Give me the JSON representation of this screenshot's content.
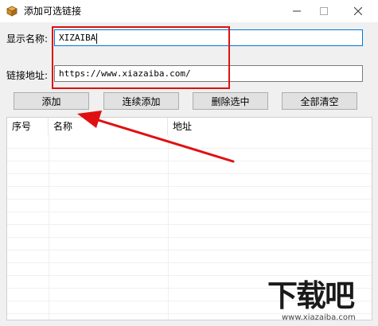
{
  "window": {
    "title": "添加可选链接"
  },
  "form": {
    "name_label": "显示名称:",
    "name_value": "XIZAIBA",
    "url_label": "链接地址:",
    "url_value": "https://www.xiazaiba.com/"
  },
  "buttons": {
    "add": "添加",
    "add_continuous": "连续添加",
    "delete_selected": "删除选中",
    "clear_all": "全部清空"
  },
  "list": {
    "columns": [
      "序号",
      "名称",
      "地址"
    ],
    "rows": []
  },
  "watermark": {
    "logo": "下载吧",
    "url": "www.xiazaiba.com"
  },
  "colors": {
    "annotation": "#e01010",
    "focus_border": "#0078d7"
  },
  "icons": {
    "app": "package-icon",
    "minimize": "minimize-icon",
    "maximize": "maximize-icon",
    "close": "close-icon"
  }
}
